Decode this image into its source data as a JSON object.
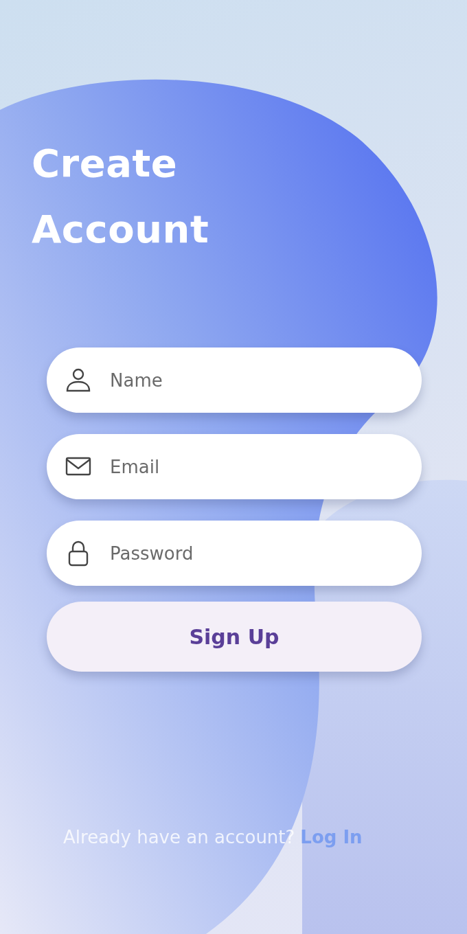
{
  "title": "Create Account",
  "fields": [
    {
      "kind": "person",
      "placeholder": "Name"
    },
    {
      "kind": "mail",
      "placeholder": "Email"
    },
    {
      "kind": "lock",
      "placeholder": "Password"
    }
  ],
  "submit": {
    "label": "Sign Up"
  },
  "footer": {
    "prompt": "Already have an account?",
    "link": "Log In"
  }
}
